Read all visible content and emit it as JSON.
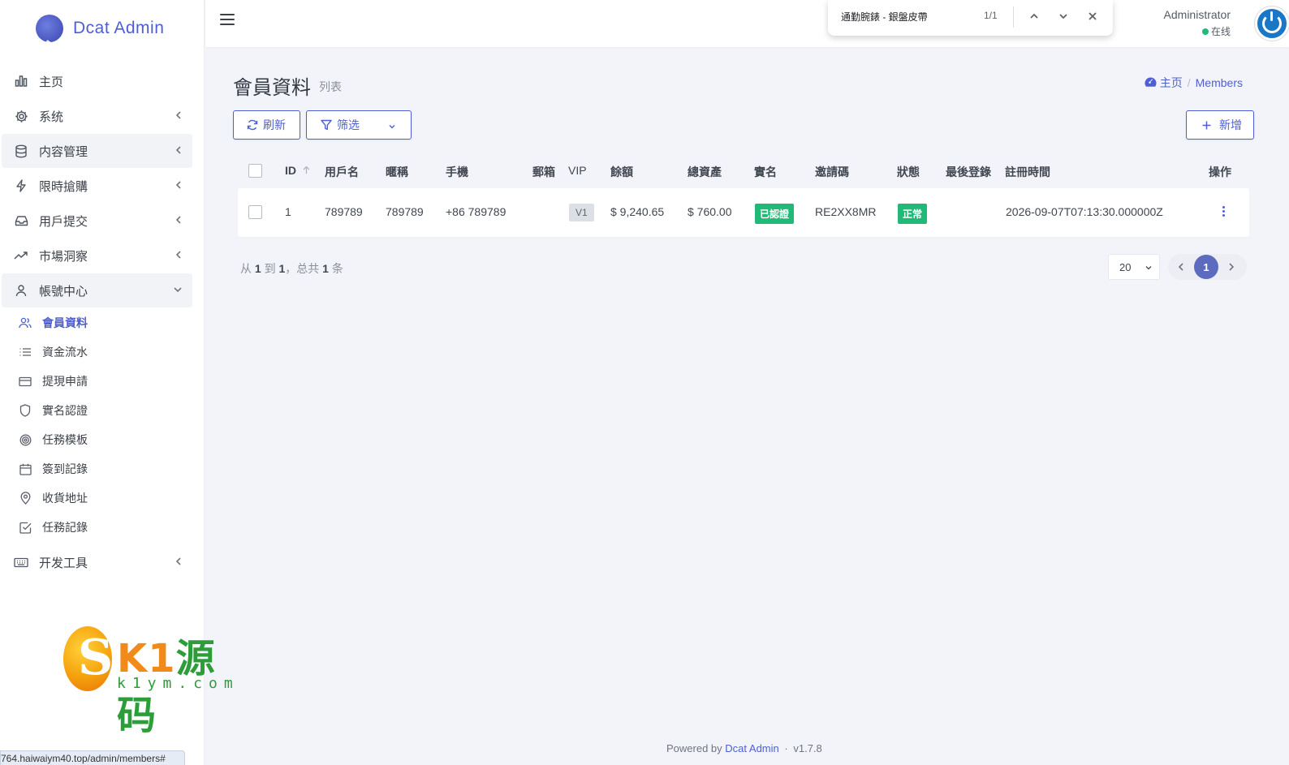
{
  "brand": {
    "name": "Dcat Admin"
  },
  "sidebar": {
    "items": [
      {
        "label": "主页",
        "icon": "bar-chart-icon"
      },
      {
        "label": "系统",
        "icon": "gear-icon"
      },
      {
        "label": "内容管理",
        "icon": "database-icon"
      },
      {
        "label": "限時搶購",
        "icon": "lightning-icon"
      },
      {
        "label": "用戶提交",
        "icon": "inbox-icon"
      },
      {
        "label": "市場洞察",
        "icon": "trending-up-icon"
      },
      {
        "label": "帳號中心",
        "icon": "user-icon"
      },
      {
        "label": "开发工具",
        "icon": "keyboard-icon"
      }
    ],
    "subitems": [
      {
        "label": "會員資料",
        "icon": "users-icon"
      },
      {
        "label": "資金流水",
        "icon": "list-icon"
      },
      {
        "label": "提現申請",
        "icon": "credit-card-icon"
      },
      {
        "label": "實名認證",
        "icon": "shield-icon"
      },
      {
        "label": "任務模板",
        "icon": "target-icon"
      },
      {
        "label": "簽到記錄",
        "icon": "calendar-icon"
      },
      {
        "label": "收貨地址",
        "icon": "map-pin-icon"
      },
      {
        "label": "任務記錄",
        "icon": "check-square-icon"
      }
    ]
  },
  "watermark": {
    "title_a": "K1",
    "title_b": "源码",
    "sub": "k1ym.com"
  },
  "status_url": "764.haiwaiym40.top/admin/members#",
  "header": {
    "user_name": "Administrator",
    "user_status": "在线"
  },
  "findbar": {
    "query": "通勤腕錶 - 銀盤皮帶",
    "count": "1/1"
  },
  "page": {
    "title": "會員資料",
    "desc": "列表"
  },
  "breadcrumb": {
    "home": "主页",
    "sep": "/",
    "current": "Members"
  },
  "toolbar": {
    "refresh": "刷新",
    "filter": "筛选",
    "new": "新增"
  },
  "table": {
    "headers": {
      "id": "ID",
      "username": "用戶名",
      "nickname": "暱稱",
      "phone": "手機",
      "email": "郵箱",
      "vip": "VIP",
      "balance": "餘額",
      "assets": "總資產",
      "realname": "實名",
      "invite": "邀請碼",
      "status": "狀態",
      "last_login": "最後登錄",
      "registered": "註冊時間",
      "actions": "操作"
    },
    "rows": [
      {
        "id": "1",
        "username": "789789",
        "nickname": "789789",
        "phone": "+86 789789",
        "email": "",
        "vip": "V1",
        "balance": "$ 9,240.65",
        "assets": "$ 760.00",
        "realname": "已認證",
        "invite": "RE2XX8MR",
        "status": "正常",
        "last_login": "",
        "registered": "2026-09-07T07:13:30.000000Z"
      }
    ]
  },
  "pagination": {
    "prefix": "从",
    "from": "1",
    "to_word": "到",
    "to": "1",
    "total_word": "，总共",
    "total": "1",
    "unit": "条",
    "per_page": "20",
    "current": "1"
  },
  "footer": {
    "powered": "Powered by",
    "link": "Dcat Admin",
    "dot": "·",
    "version": "v1.7.8"
  },
  "colors": {
    "primary": "#4d5fd3",
    "success": "#21b978",
    "background": "#f3f4f9"
  }
}
